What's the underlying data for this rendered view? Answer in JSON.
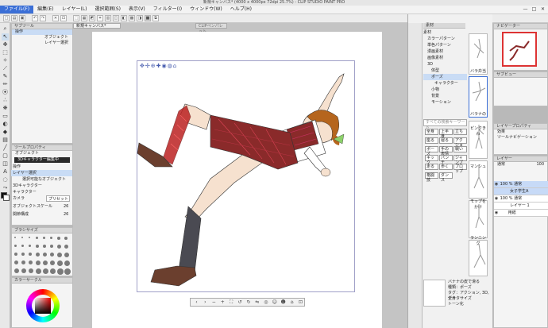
{
  "window": {
    "title": "新規キャンバス* (4000 x 4000px 72dpi 25.7%) - CLIP STUDIO PAINT PRO",
    "controls": [
      "—",
      "□",
      "✕"
    ]
  },
  "menu": [
    "ファイル(F)",
    "編集(E)",
    "レイヤー(L)",
    "選択範囲(S)",
    "表示(V)",
    "フィルター(I)",
    "ウィンドウ(W)",
    "ヘルプ(H)"
  ],
  "sub_tool_panel": {
    "header": "サブツール",
    "items": [
      "操作",
      "オブジェクト",
      "レイヤー選択"
    ]
  },
  "tool_property": {
    "header": "ツールプロパティ",
    "subheader": "オブジェクト",
    "section": "3Dキャラクター編集中",
    "rows": [
      "操作",
      "レイヤー選択",
      "選択可能なオブジェクト",
      "3Dキャラクター",
      "キャラクター",
      "カメラ",
      "オブジェクトスケール",
      "関節構成"
    ],
    "values": {
      "camera": "プリセット",
      "scale": "26",
      "joints": "26"
    }
  },
  "brush_size": {
    "header": "ブラシサイズ"
  },
  "color_wheel": {
    "header": "カラーサークル"
  },
  "document": {
    "tab": "新規キャンバス*",
    "tab2": "CLIPペンパレット"
  },
  "material": {
    "header": "素材",
    "tree": [
      "素材",
      "カラーパターン",
      "単色パターン",
      "漫画素材",
      "画像素材",
      "3D",
      "体型",
      "ポーズ",
      "キャラクター",
      "小物",
      "背景",
      "モーション"
    ],
    "search_placeholder": "すべての検索キーワード",
    "tags": [
      "全身",
      "上半身",
      "立ち",
      "座る",
      "寝る",
      "アクション",
      "ポーズ",
      "手の表情",
      "戦い",
      "キック",
      "パンチ",
      "ジャンプ",
      "走る",
      "歩く",
      "プロップ",
      "格闘技",
      "ダンス"
    ],
    "thumbs": [
      "バラ弁当",
      "バラナの",
      "ピンクきわ",
      "マンシュ",
      "モップをかけ",
      "ランニング"
    ],
    "detail": {
      "title": "バナナの皮で滑る",
      "kind": "種類：ポーズ",
      "tags": "タグ：アクション, 3D, 全身",
      "size": "データサイズ",
      "lang": "トーン化"
    }
  },
  "navigator": {
    "header": "ナビゲーター"
  },
  "sub_view": {
    "header": "サブビュー"
  },
  "layer_property": {
    "header": "レイヤープロパティ",
    "effect": "効果",
    "tone": "ツールナビゲーション"
  },
  "layers": {
    "header": "レイヤー",
    "blend": "通常",
    "opacity": "100",
    "rows": [
      {
        "name": "3D",
        "detail": "100 % 通常",
        "sub": "女子学生A"
      },
      {
        "name": "レイヤー 1",
        "detail": "100 % 通常"
      },
      {
        "name": "用紙",
        "detail": ""
      }
    ]
  },
  "colors": {
    "accent": "#3b6fd6",
    "selection": "#c9dcf5",
    "skirt": "#8a2a2a",
    "skin": "#f6e1cf",
    "hair": "#b5651d",
    "sock": "#4a4a52",
    "shoe": "#6b3f2e"
  }
}
